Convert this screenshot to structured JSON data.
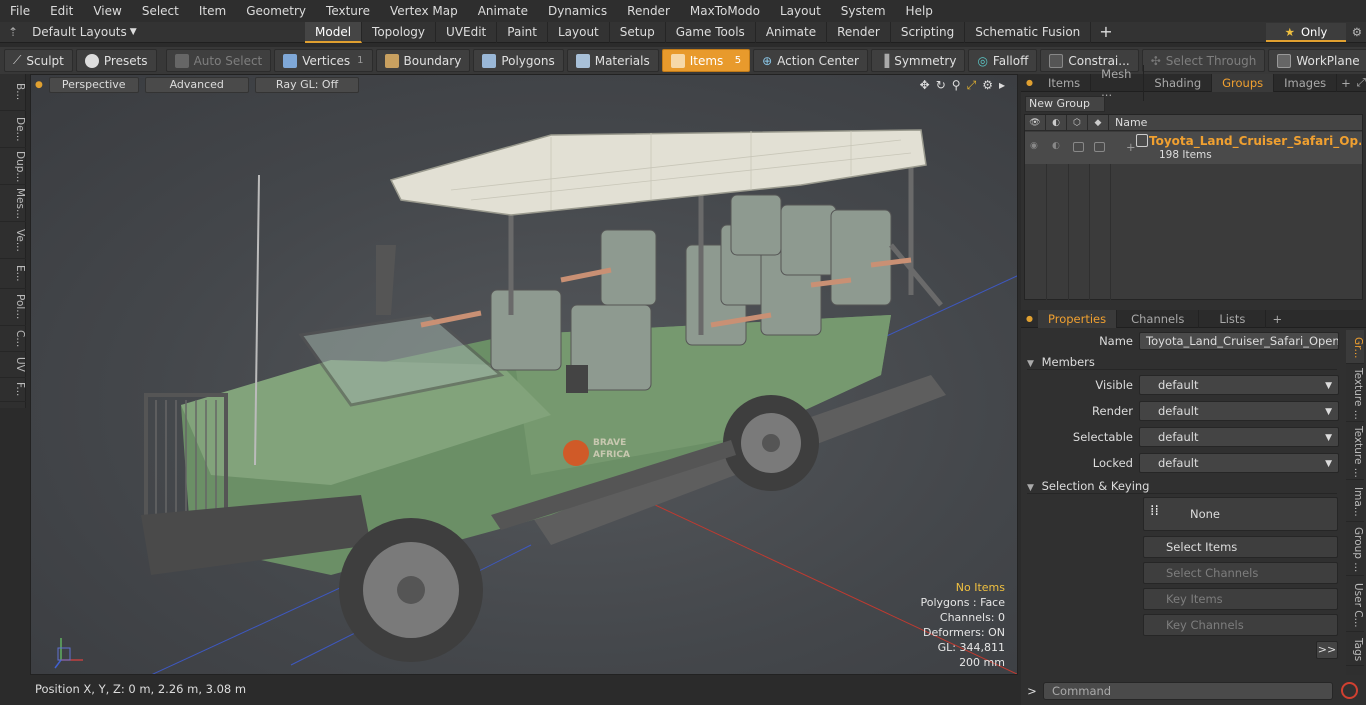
{
  "menu": [
    "File",
    "Edit",
    "View",
    "Select",
    "Item",
    "Geometry",
    "Texture",
    "Vertex Map",
    "Animate",
    "Dynamics",
    "Render",
    "MaxToModo",
    "Layout",
    "System",
    "Help"
  ],
  "layouts_label": "Default Layouts",
  "mode_tabs": [
    "Model",
    "Topology",
    "UVEdit",
    "Paint",
    "Layout",
    "Setup",
    "Game Tools",
    "Animate",
    "Render",
    "Scripting",
    "Schematic Fusion"
  ],
  "only_label": "Only",
  "toolbar": {
    "sculpt": "Sculpt",
    "presets": "Presets",
    "auto_select": "Auto Select",
    "vertices": "Vertices",
    "vertices_count": "1",
    "boundary": "Boundary",
    "polygons": "Polygons",
    "materials": "Materials",
    "items": "Items",
    "items_count": "5",
    "action_center": "Action Center",
    "symmetry": "Symmetry",
    "falloff": "Falloff",
    "constraints": "Constrai...",
    "select_through": "Select Through",
    "workplane": "WorkPlane"
  },
  "left_tabs": [
    "B...",
    "De...",
    "Dup...",
    "Mes...",
    "Ve...",
    "E...",
    "Pol...",
    "C...",
    "UV",
    "F..."
  ],
  "viewport": {
    "perspective": "Perspective",
    "advanced": "Advanced",
    "raygl": "Ray GL: Off",
    "logo_top": "BRAVE",
    "logo_bottom": "AFRICA"
  },
  "stats": {
    "items": "No Items",
    "polygons": "Polygons : Face",
    "channels": "Channels: 0",
    "deformers": "Deformers: ON",
    "gl": "GL: 344,811",
    "scale": "200 mm"
  },
  "status": "Position X, Y, Z:   0 m, 2.26 m, 3.08 m",
  "top_tabs": [
    "Items",
    "Mesh ...",
    "Shading",
    "Groups",
    "Images"
  ],
  "new_group": "New Group",
  "groups_header": {
    "name": "Name"
  },
  "group": {
    "name": "Toyota_Land_Cruiser_Safari_Op...",
    "count": "198 Items"
  },
  "prop_tabs": [
    "Properties",
    "Channels",
    "Lists"
  ],
  "properties": {
    "name_label": "Name",
    "name_value": "Toyota_Land_Cruiser_Safari_Open_Si",
    "members": "Members",
    "visible_label": "Visible",
    "render_label": "Render",
    "selectable_label": "Selectable",
    "locked_label": "Locked",
    "default": "default",
    "selection_keying": "Selection & Keying",
    "none": "None",
    "select_items": "Select Items",
    "select_channels": "Select Channels",
    "key_items": "Key Items",
    "key_channels": "Key Channels",
    "more": ">>"
  },
  "right_vtabs": [
    "Gr...",
    "Texture ...",
    "Texture ...",
    "Ima...",
    "Group ...",
    "User C...",
    "Tags"
  ],
  "command_placeholder": "Command",
  "colors": {
    "accent": "#e89a2c",
    "body_green": "#6b8f66",
    "roof": "#e2e0d4"
  }
}
